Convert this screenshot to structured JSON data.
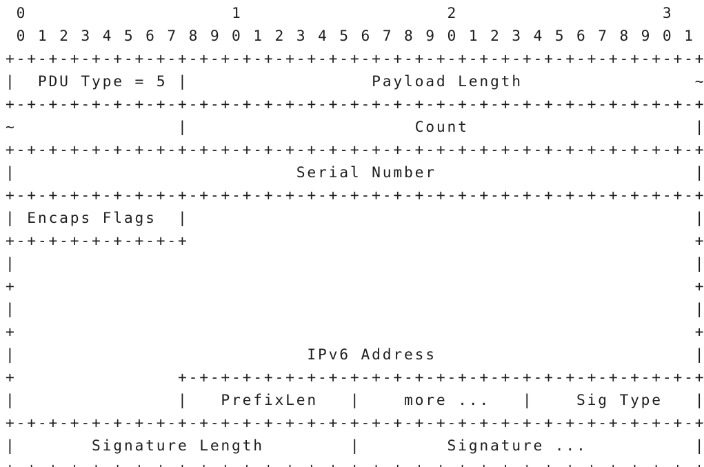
{
  "diagram": {
    "lines": [
      " 0                   1                   2                   3",
      " 0 1 2 3 4 5 6 7 8 9 0 1 2 3 4 5 6 7 8 9 0 1 2 3 4 5 6 7 8 9 0 1",
      "+-+-+-+-+-+-+-+-+-+-+-+-+-+-+-+-+-+-+-+-+-+-+-+-+-+-+-+-+-+-+-+-+",
      "|  PDU Type = 5 |                 Payload Length                ~",
      "+-+-+-+-+-+-+-+-+-+-+-+-+-+-+-+-+-+-+-+-+-+-+-+-+-+-+-+-+-+-+-+-+",
      "~               |                     Count                     |",
      "+-+-+-+-+-+-+-+-+-+-+-+-+-+-+-+-+-+-+-+-+-+-+-+-+-+-+-+-+-+-+-+-+",
      "|                          Serial Number                        |",
      "+-+-+-+-+-+-+-+-+-+-+-+-+-+-+-+-+-+-+-+-+-+-+-+-+-+-+-+-+-+-+-+-+",
      "| Encaps Flags  |                                               |",
      "+-+-+-+-+-+-+-+-+                                               +",
      "|                                                               |",
      "+                                                               +",
      "|                                                               |",
      "+                                                               +",
      "|                           IPv6 Address                        |",
      "+               +-+-+-+-+-+-+-+-+-+-+-+-+-+-+-+-+-+-+-+-+-+-+-+-+",
      "|               |   PrefixLen   |    more ...   |    Sig Type   |",
      "+-+-+-+-+-+-+-+-+-+-+-+-+-+-+-+-+-+-+-+-+-+-+-+-+-+-+-+-+-+-+-+-+",
      "|       Signature Length        |        Signature ...          |",
      "+-+-+-+-+-+-+-+-+-+-+-+-+-+-+-+-+-+-+-+-+-+-+-+-+-+-+-+-+-+-+-+-+"
    ]
  }
}
